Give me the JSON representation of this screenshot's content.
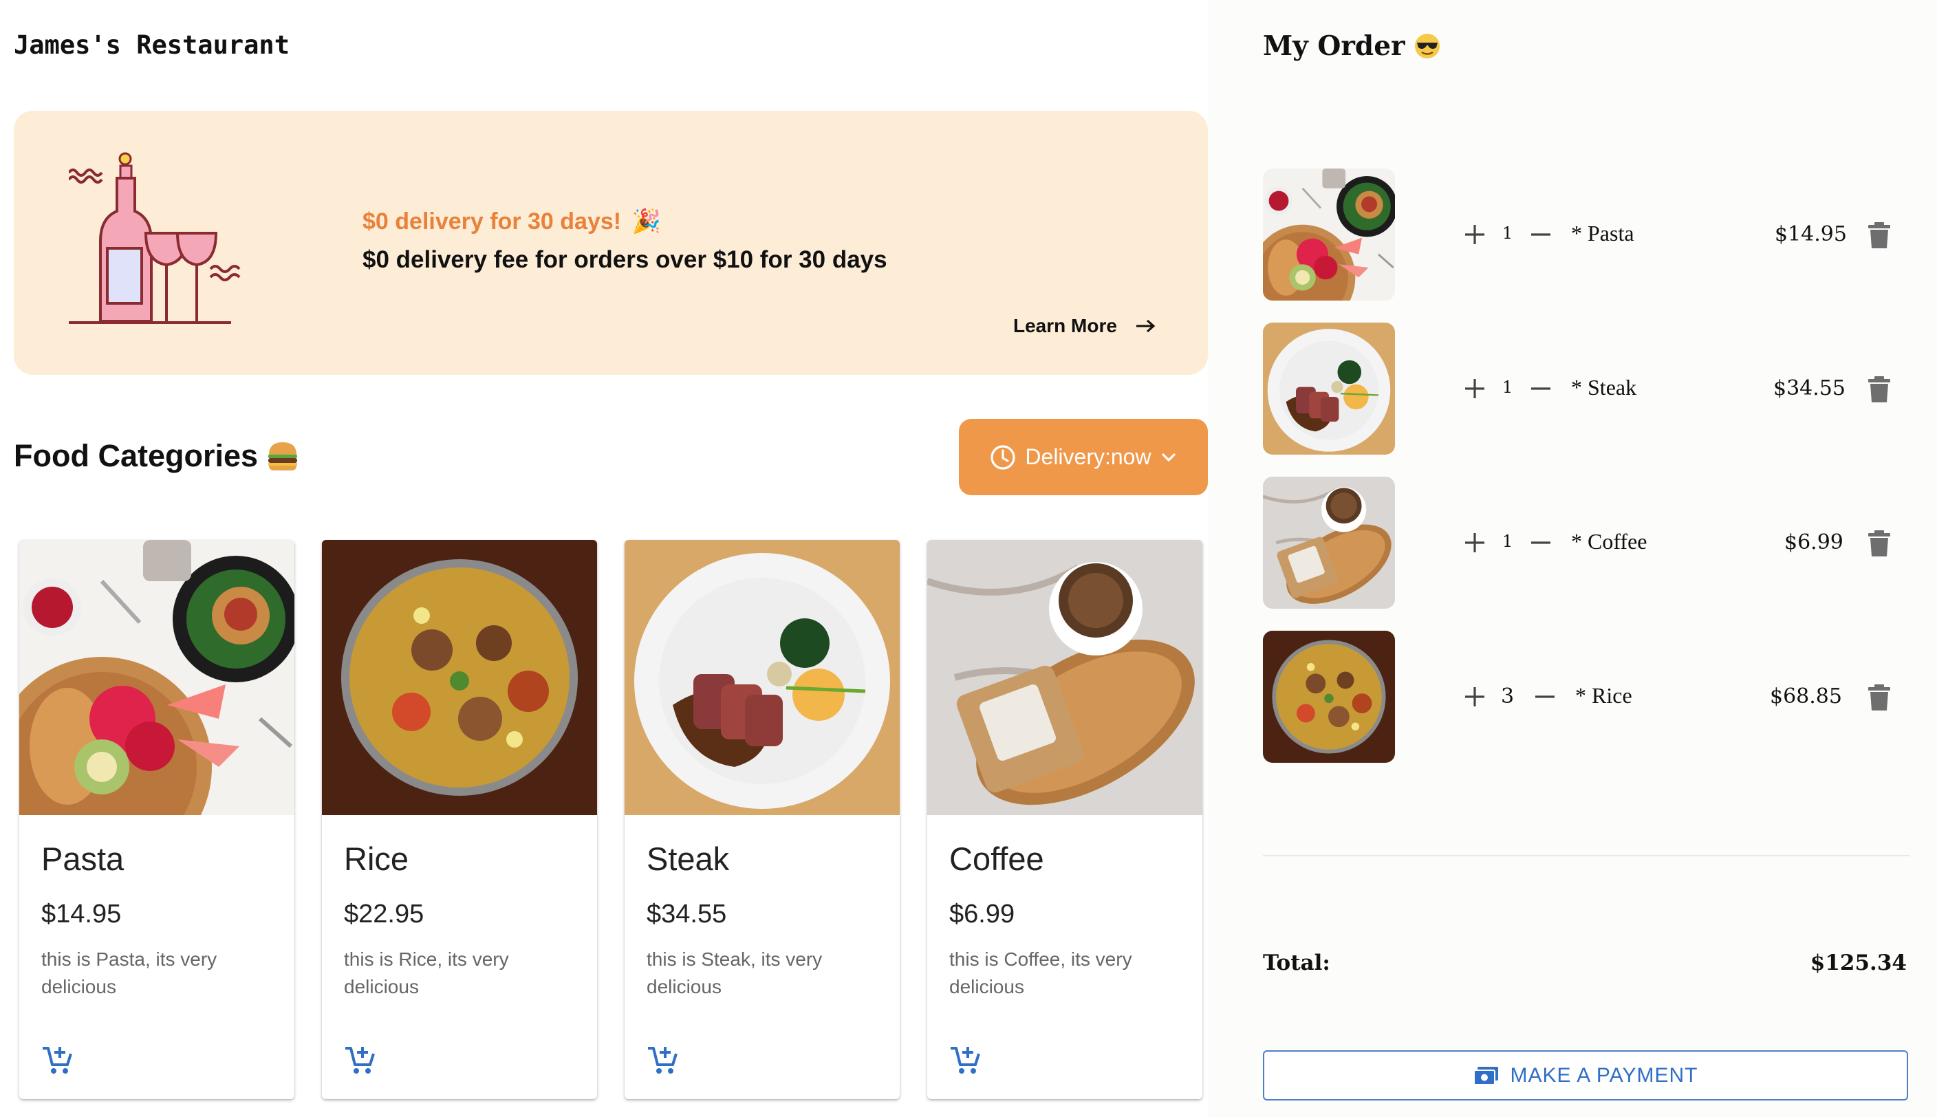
{
  "restaurant": {
    "title": "James's Restaurant"
  },
  "promo": {
    "headline": "$0 delivery for 30 days!",
    "subline": "$0 delivery fee for orders over $10 for 30 days",
    "cta_label": "Learn More",
    "accent_color": "#e8823a",
    "background_color": "#fdecd6"
  },
  "categories": {
    "title": "Food Categories",
    "delivery_label": "Delivery:now",
    "delivery_color": "#f0984a",
    "items": [
      {
        "name": "Pasta",
        "price": "$14.95",
        "description": "this is Pasta, its very delicious",
        "icon": "add-to-cart-icon"
      },
      {
        "name": "Rice",
        "price": "$22.95",
        "description": "this is Rice, its very delicious",
        "icon": "add-to-cart-icon"
      },
      {
        "name": "Steak",
        "price": "$34.55",
        "description": "this is Steak, its very delicious",
        "icon": "add-to-cart-icon"
      },
      {
        "name": "Coffee",
        "price": "$6.99",
        "description": "this is Coffee, its very delicious",
        "icon": "add-to-cart-icon"
      }
    ]
  },
  "order": {
    "title": "My Order",
    "items": [
      {
        "name": "* Pasta",
        "qty": "1",
        "price": "$14.95"
      },
      {
        "name": "* Steak",
        "qty": "1",
        "price": "$34.55"
      },
      {
        "name": "* Coffee",
        "qty": "1",
        "price": "$6.99"
      },
      {
        "name": "* Rice",
        "qty": "3",
        "price": "$68.85"
      }
    ],
    "total_label": "Total:",
    "total_value": "$125.34",
    "payment_label": "MAKE A PAYMENT",
    "accent_color": "#2f6fc6"
  }
}
